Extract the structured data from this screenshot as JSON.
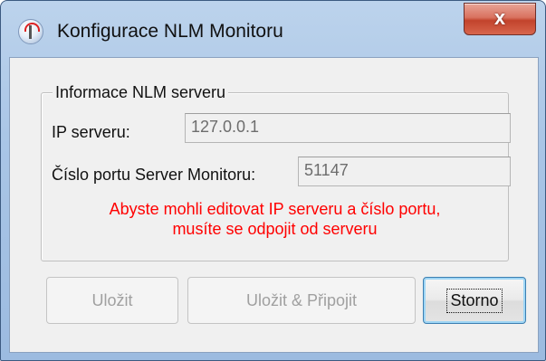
{
  "window": {
    "title": "Konfigurace NLM Monitoru",
    "close_label": "x",
    "icon": "radio-tower-icon"
  },
  "group": {
    "title": "Informace NLM serveru",
    "ip_label": "IP serveru:",
    "ip_value": "127.0.0.1",
    "port_label": "Číslo portu Server Monitoru:",
    "port_value": "51147",
    "warning_line1": "Abyste mohli editovat IP serveru a číslo portu,",
    "warning_line2": "musíte se odpojit od serveru"
  },
  "buttons": {
    "save": "Uložit",
    "save_connect": "Uložit & Připojit",
    "cancel": "Storno"
  },
  "colors": {
    "warning": "#ff0000",
    "disabled_text": "#a0a0a0",
    "close_button": "#c2432c"
  }
}
